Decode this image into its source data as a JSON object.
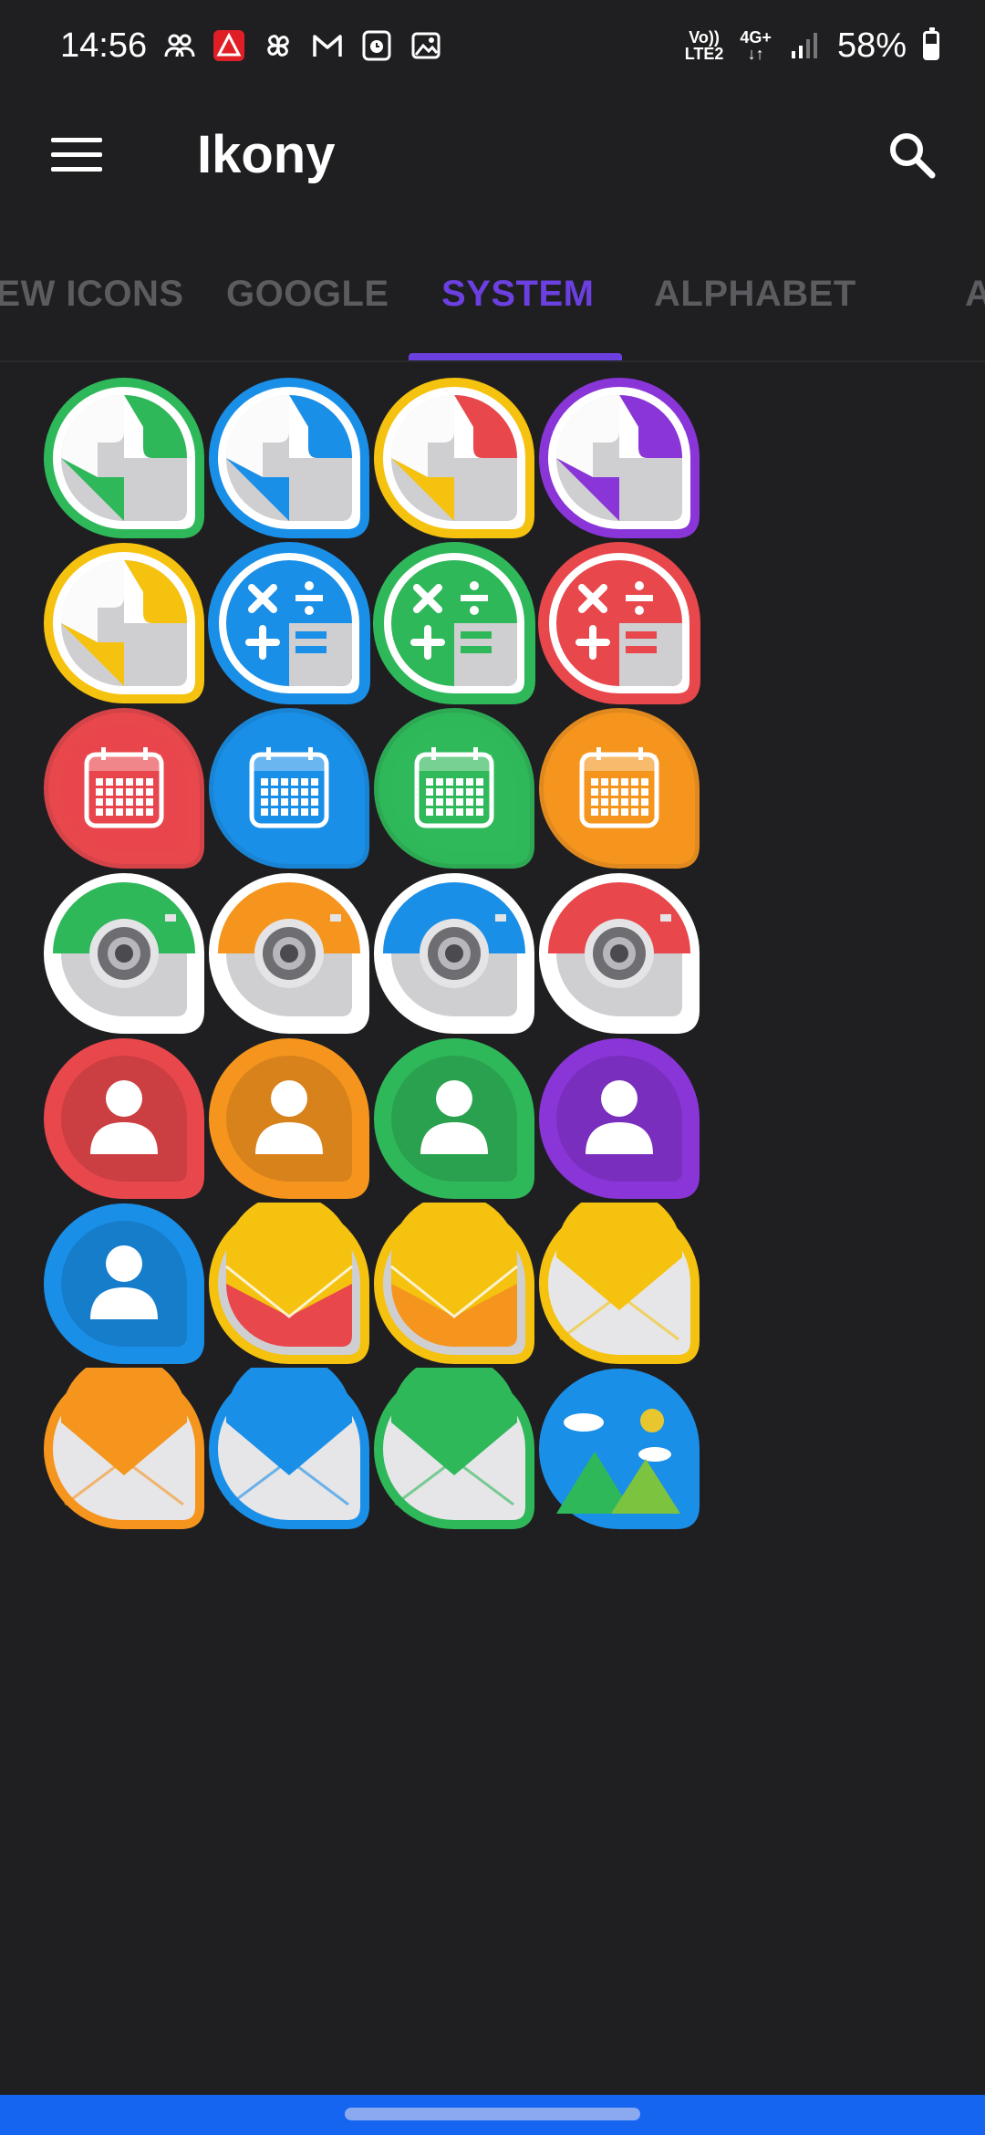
{
  "status": {
    "time": "14:56",
    "net_top": "Vo))",
    "net_bottom": "LTE2",
    "net_type": "4G+",
    "battery": "58%",
    "battery_level": 0.58
  },
  "app": {
    "title": "Ikony"
  },
  "tabs": [
    {
      "label": "NEW ICONS",
      "active": false
    },
    {
      "label": "GOOGLE",
      "active": false
    },
    {
      "label": "SYSTEM",
      "active": true
    },
    {
      "label": "ALPHABET",
      "active": false
    },
    {
      "label": "A",
      "active": false
    }
  ],
  "colors": {
    "accent": "#6b3fe0",
    "green": "#2fb85a",
    "blue": "#1a8fe8",
    "yellow": "#f5c20f",
    "red": "#e8474c",
    "purple": "#8a35d8",
    "orange": "#f5951e"
  },
  "icons": [
    [
      "maps-icon-green",
      "maps-icon-blue",
      "maps-icon-yellow-red",
      "maps-icon-purple"
    ],
    [
      "maps-icon-yellow",
      "calculator-icon-blue",
      "calculator-icon-green",
      "calculator-icon-red"
    ],
    [
      "calendar-icon-red",
      "calendar-icon-blue",
      "calendar-icon-green",
      "calendar-icon-orange"
    ],
    [
      "camera-icon-green",
      "camera-icon-orange",
      "camera-icon-blue",
      "camera-icon-red"
    ],
    [
      "contacts-icon-red",
      "contacts-icon-orange",
      "contacts-icon-green",
      "contacts-icon-purple"
    ],
    [
      "contacts-icon-blue",
      "email-icon-red",
      "email-icon-orange",
      "email-icon-white"
    ],
    [
      "email-icon-orange",
      "email-icon-blue",
      "email-icon-green",
      "gallery-icon"
    ]
  ]
}
